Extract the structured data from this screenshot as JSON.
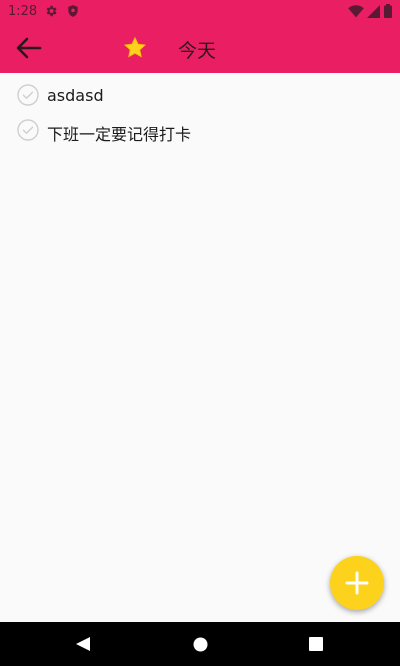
{
  "status_bar": {
    "time": "1:28",
    "icons": [
      "gear-icon",
      "shield-icon",
      "wifi-icon",
      "signal-icon",
      "battery-icon"
    ]
  },
  "toolbar": {
    "title": "今天",
    "back_icon": "arrow-left-icon",
    "title_icon": "star-icon",
    "color": "#e91e63"
  },
  "tasks": [
    {
      "text": "asdasd",
      "checked": false
    },
    {
      "text": "下班一定要记得打卡",
      "checked": false
    }
  ],
  "fab": {
    "icon": "plus-icon",
    "color": "#fdd21c"
  },
  "nav_bar": {
    "icons": [
      "nav-back-icon",
      "nav-home-icon",
      "nav-recents-icon"
    ]
  }
}
